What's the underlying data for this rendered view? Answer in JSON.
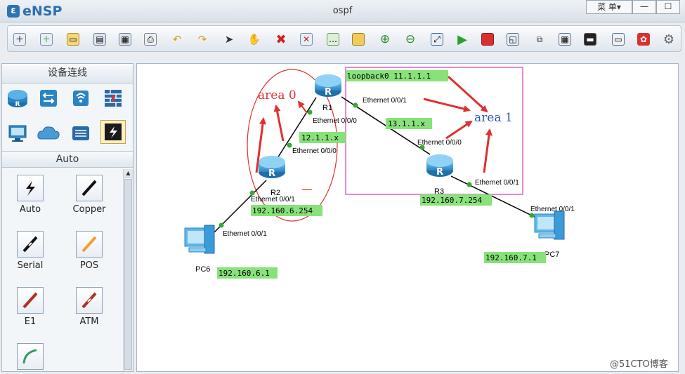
{
  "app": {
    "logo_mark": "ε",
    "logo_text": "eNSP",
    "window_title": "ospf",
    "menu_label": "菜 单▾",
    "minimize": "—",
    "maximize": "☐"
  },
  "toolbar": {
    "icons": [
      "new-topology-icon",
      "new-lab-icon",
      "open-icon",
      "save-icon",
      "save-as-icon",
      "print-icon",
      "undo-icon",
      "redo-icon",
      "select-icon",
      "hand-icon",
      "delete-icon",
      "delete-connection-icon",
      "text-icon",
      "rectangle-icon",
      "zoom-in-icon",
      "zoom-out-icon",
      "fit-icon",
      "start-icon",
      "stop-icon",
      "capture-icon",
      "topology-icon",
      "grid-icon",
      "console-icon",
      "chat-icon",
      "huawei-icon",
      "settings-icon"
    ]
  },
  "left_panel": {
    "header": "设备连线",
    "devices": [
      "router-icon",
      "switch-icon",
      "wireless-icon",
      "firewall-icon",
      "pc-icon",
      "cloud-icon",
      "other-device-icon",
      "cable-icon"
    ],
    "section": "Auto",
    "cables": [
      {
        "label": "Auto"
      },
      {
        "label": "Copper"
      },
      {
        "label": "Serial"
      },
      {
        "label": "POS"
      },
      {
        "label": "E1"
      },
      {
        "label": "ATM"
      },
      {
        "label": ""
      }
    ]
  },
  "topology": {
    "devices": {
      "r1": "R1",
      "r2": "R2",
      "r3": "R3",
      "pc6": "PC6",
      "pc7": "PC7"
    },
    "ports": {
      "r1_e000": "Ethernet 0/0/0",
      "r1_e001": "Ethernet 0/0/1",
      "r2_e000": "Ethernet 0/0/0",
      "r2_e001": "Ethernet 0/0/1",
      "pc6_e001": "Ethernet 0/0/1",
      "r3_e000": "Ethernet 0/0/0",
      "r3_e001": "Ethernet 0/0/1",
      "pc7_e001": "Ethernet 0/0/1"
    },
    "labels": {
      "loopback": "loopback0  11.1.1.1",
      "net_r1_r2": "12.1.1.x",
      "net_r1_r3": "13.1.1.x",
      "r2_ip": "192.160.6.254",
      "pc6_ip": "192.160.6.1",
      "r3_ip": "192.160.7.254",
      "pc7_ip": "192.160.7.1"
    },
    "annotations": {
      "area0": "area 0",
      "area1": "area 1",
      "dash": "—"
    },
    "colors": {
      "annotation_red": "#e03030",
      "area1_blue": "#3355b0",
      "label_green": "#88e27a",
      "area1_box": "#e060c0",
      "link_green": "#33aa33"
    }
  },
  "watermark": "@51CTO博客"
}
